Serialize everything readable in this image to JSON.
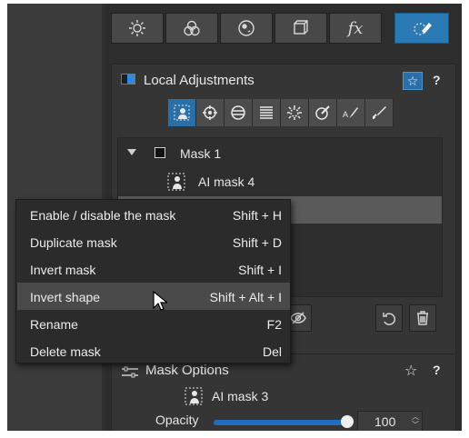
{
  "tabs": [
    {
      "name": "light",
      "icon": "sun-icon"
    },
    {
      "name": "color",
      "icon": "color-circles-icon"
    },
    {
      "name": "detail",
      "icon": "lens-icon"
    },
    {
      "name": "geometry",
      "icon": "cube-icon"
    },
    {
      "name": "effects",
      "icon": "fx-icon",
      "label": "fx"
    },
    {
      "name": "local",
      "icon": "brush-mask-icon",
      "active": true
    }
  ],
  "local_adjustments": {
    "title": "Local Adjustments",
    "help": "?",
    "tools": [
      "ai-person-mask-icon",
      "target-icon",
      "radial-icon",
      "gradient-icon",
      "auto-icon",
      "color-picker-icon",
      "ai-brush-icon",
      "brush-icon"
    ]
  },
  "mask_list": {
    "group_name": "Mask 1",
    "items": [
      {
        "label": "AI mask 4"
      }
    ]
  },
  "context_menu": {
    "items": [
      {
        "label": "Enable / disable the mask",
        "shortcut": "Shift + H"
      },
      {
        "label": "Duplicate mask",
        "shortcut": "Shift + D"
      },
      {
        "label": "Invert mask",
        "shortcut": "Shift + I"
      },
      {
        "label": "Invert shape",
        "shortcut": "Shift + Alt + I",
        "hovered": true
      },
      {
        "label": "Rename",
        "shortcut": "F2"
      },
      {
        "label": "Delete mask",
        "shortcut": "Del"
      }
    ]
  },
  "mask_options": {
    "title": "Mask Options",
    "help": "?",
    "mask_name": "AI mask 3",
    "opacity_label": "Opacity",
    "opacity_value": "100",
    "opacity_fraction": 1.0
  },
  "colors": {
    "accent": "#2a6fa8",
    "panel": "#353535",
    "menu": "#2b2b2b",
    "menu_hover": "#4a4a4a"
  }
}
